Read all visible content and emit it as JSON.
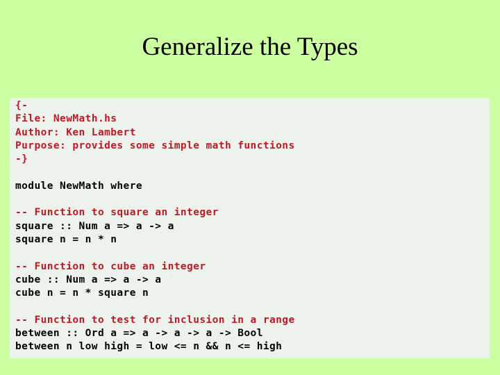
{
  "slide": {
    "title": "Generalize the Types",
    "background_color": "#ccffa0",
    "panel_background_color": "#eef2ec",
    "comment_color": "#c01825",
    "code_color": "#000000"
  },
  "code": {
    "language": "haskell",
    "lines": [
      {
        "text": "{-",
        "kind": "comment"
      },
      {
        "text": "File: NewMath.hs",
        "kind": "comment"
      },
      {
        "text": "Author: Ken Lambert",
        "kind": "comment"
      },
      {
        "text": "Purpose: provides some simple math functions",
        "kind": "comment"
      },
      {
        "text": "-}",
        "kind": "comment"
      },
      {
        "text": "",
        "kind": "blank"
      },
      {
        "text": "module NewMath where",
        "kind": "code"
      },
      {
        "text": "",
        "kind": "blank"
      },
      {
        "text": "-- Function to square an integer",
        "kind": "comment"
      },
      {
        "text": "square :: Num a => a -> a",
        "kind": "code"
      },
      {
        "text": "square n = n * n",
        "kind": "code"
      },
      {
        "text": "",
        "kind": "blank"
      },
      {
        "text": "-- Function to cube an integer",
        "kind": "comment"
      },
      {
        "text": "cube :: Num a => a -> a",
        "kind": "code"
      },
      {
        "text": "cube n = n * square n",
        "kind": "code"
      },
      {
        "text": "",
        "kind": "blank"
      },
      {
        "text": "-- Function to test for inclusion in a range",
        "kind": "comment"
      },
      {
        "text": "between :: Ord a => a -> a -> a -> Bool",
        "kind": "code"
      },
      {
        "text": "between n low high = low <= n && n <= high",
        "kind": "code"
      }
    ]
  }
}
